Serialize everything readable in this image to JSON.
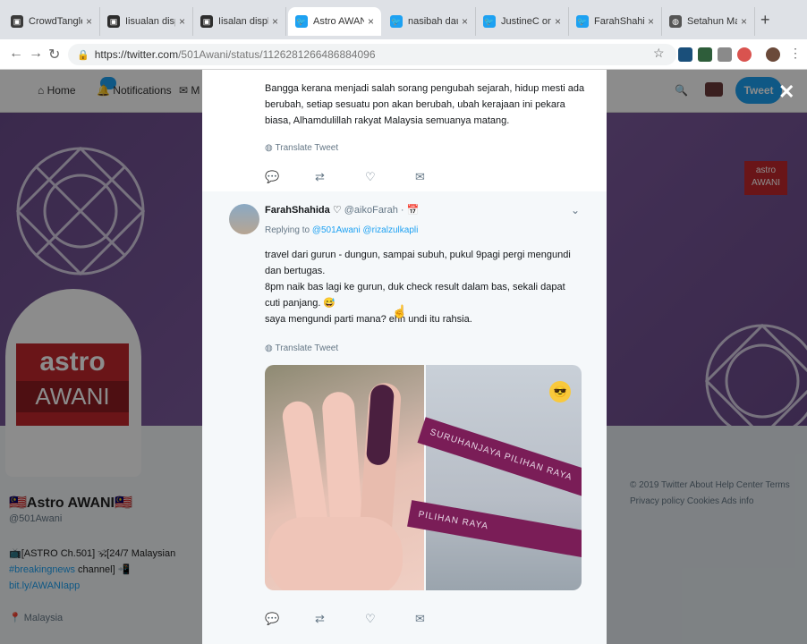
{
  "browser": {
    "tabs": [
      {
        "title": "CrowdTangle",
        "favicon_color": "#3a3a3a",
        "active": false
      },
      {
        "title": "Iisualan displa",
        "favicon_color": "#2d2d2d",
        "active": false
      },
      {
        "title": "Iisalan displa",
        "favicon_color": "#2d2d2d",
        "active": false
      },
      {
        "title": "Astro AWANI",
        "favicon_color": "#1da1f2",
        "active": true
      },
      {
        "title": "nasibah dauci",
        "favicon_color": "#1da1f2",
        "active": false
      },
      {
        "title": "JustineC on Ti",
        "favicon_color": "#1da1f2",
        "active": false
      },
      {
        "title": "FarahShahida",
        "favicon_color": "#1da1f2",
        "active": false
      },
      {
        "title": "Setahun Malay",
        "favicon_color": "#555555",
        "active": false
      }
    ],
    "new_tab_glyph": "+",
    "url_host": "https://twitter.com",
    "url_path": "/501Awani/status/1126281266486884096",
    "nav": {
      "back": "←",
      "forward": "→",
      "reload": "↻"
    }
  },
  "twitter_page": {
    "nav_home": "Home",
    "nav_notifications": "Notifications",
    "nav_messages": "M",
    "notif_count": "",
    "tweet_button": "Tweet",
    "close_glyph": "✕",
    "profile": {
      "logo_line1": "astro",
      "logo_line2": "AWANI",
      "name": "🇲🇾Astro AWANI🇲🇾",
      "handle": "@501Awani",
      "bio_line1": "📺[ASTRO Ch.501] 🕉[24/7 Malaysian",
      "bio_line2_hashtag": "#breakingnews",
      "bio_line2_rest": " channel] 📲",
      "bio_link": "bit.ly/AWANIapp",
      "location": "Malaysia"
    },
    "right_logo_line1": "astro",
    "right_logo_line2": "AWANI",
    "footer": "© 2019 Twitter  About  Help Center  Terms  Privacy policy  Cookies  Ads info"
  },
  "tweet1": {
    "text": "Bangga kerana menjadi salah sorang pengubah sejarah, hidup mesti ada berubah, setiap sesuatu pon akan berubah, ubah kerajaan ini pekara biasa, Alhamdulillah rakyat Malaysia semuanya matang.",
    "translate": "Translate Tweet"
  },
  "tweet2": {
    "name": "FarahShahida",
    "handle": "@aikoFarah",
    "replying_prefix": "Replying to",
    "replying_mentions": "@501Awani @rizalzulkapli",
    "line1": "travel dari gurun - dungun, sampai subuh, pukul 9pagi pergi mengundi dan bertugas.",
    "line2": "8pm naik bas lagi ke gurun, duk check result dalam bas, sekali dapat cuti panjang. 😅",
    "line3": "saya mengundi parti mana? ehh undi itu rahsia.",
    "translate": "Translate Tweet",
    "ribbon1": "SURUHANJAYA PILIHAN RAYA",
    "ribbon2": "PILIHAN RAYA"
  },
  "icons": {
    "reply": "reply-icon",
    "retweet": "retweet-icon",
    "like": "like-icon",
    "dm": "dm-icon"
  }
}
